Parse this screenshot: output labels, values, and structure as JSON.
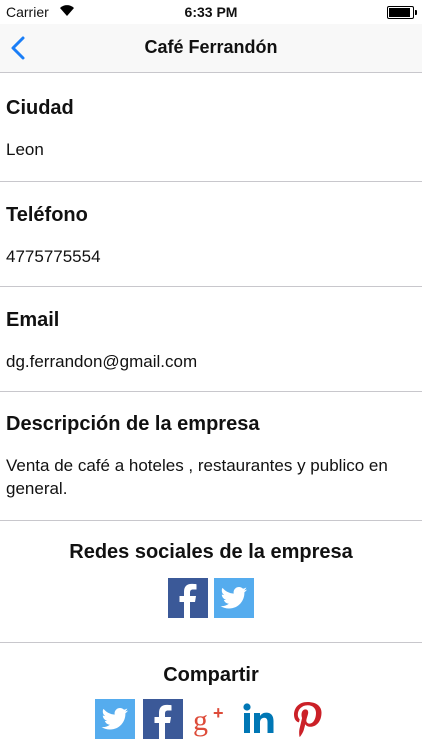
{
  "status_bar": {
    "carrier": "Carrier",
    "time": "6:33 PM",
    "battery_level": 1.0
  },
  "nav": {
    "title": "Café Ferrandón",
    "back_icon": "chevron-left-icon"
  },
  "fields": {
    "ciudad": {
      "label": "Ciudad",
      "value": "Leon"
    },
    "telefono": {
      "label": "Teléfono",
      "value": "4775775554"
    },
    "email": {
      "label": "Email",
      "value": "dg.ferrandon@gmail.com"
    },
    "descripcion": {
      "label": "Descripción de la empresa",
      "value": "Venta de café a hoteles , restaurantes y publico en general."
    }
  },
  "redes": {
    "heading": "Redes sociales de la empresa",
    "icons": [
      "facebook-icon",
      "twitter-icon"
    ]
  },
  "compartir": {
    "heading": "Compartir",
    "icons": [
      "twitter-icon",
      "facebook-icon",
      "google-plus-icon",
      "linkedin-icon",
      "pinterest-icon"
    ]
  },
  "colors": {
    "accent": "#1a7ef7",
    "facebook": "#3b5998",
    "twitter": "#55acee",
    "google_plus": "#dd4b39",
    "linkedin": "#0077b5",
    "pinterest": "#cb2027"
  }
}
